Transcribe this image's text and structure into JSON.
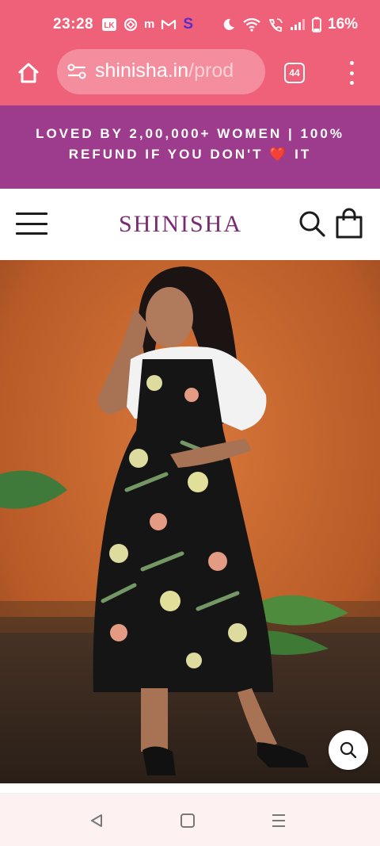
{
  "status_bar": {
    "time": "23:28",
    "notification_icons": [
      "lk-icon",
      "shield-icon",
      "m",
      "gmail-icon",
      "s"
    ],
    "app_letters": {
      "m": "m",
      "s": "S"
    },
    "battery_percent": "16%"
  },
  "browser": {
    "url_domain": "shinisha.in",
    "url_path": "/prod",
    "tab_count": "44"
  },
  "promo": {
    "text": "LOVED BY 2,00,000+ WOMEN | 100% REFUND IF YOU DON'T ❤️ IT",
    "line1": "LOVED BY 2,00,000+ WOMEN | 100%",
    "line2": "REFUND IF YOU DON'T ❤️ IT",
    "background": "#9d3c8c"
  },
  "header": {
    "brand": "SHINISHA",
    "brand_color": "#7a2a73"
  },
  "product": {
    "image_description": "woman-in-black-floral-dress"
  },
  "colors": {
    "browser_chrome": "#ef6079",
    "url_pill": "#f48e9f"
  }
}
